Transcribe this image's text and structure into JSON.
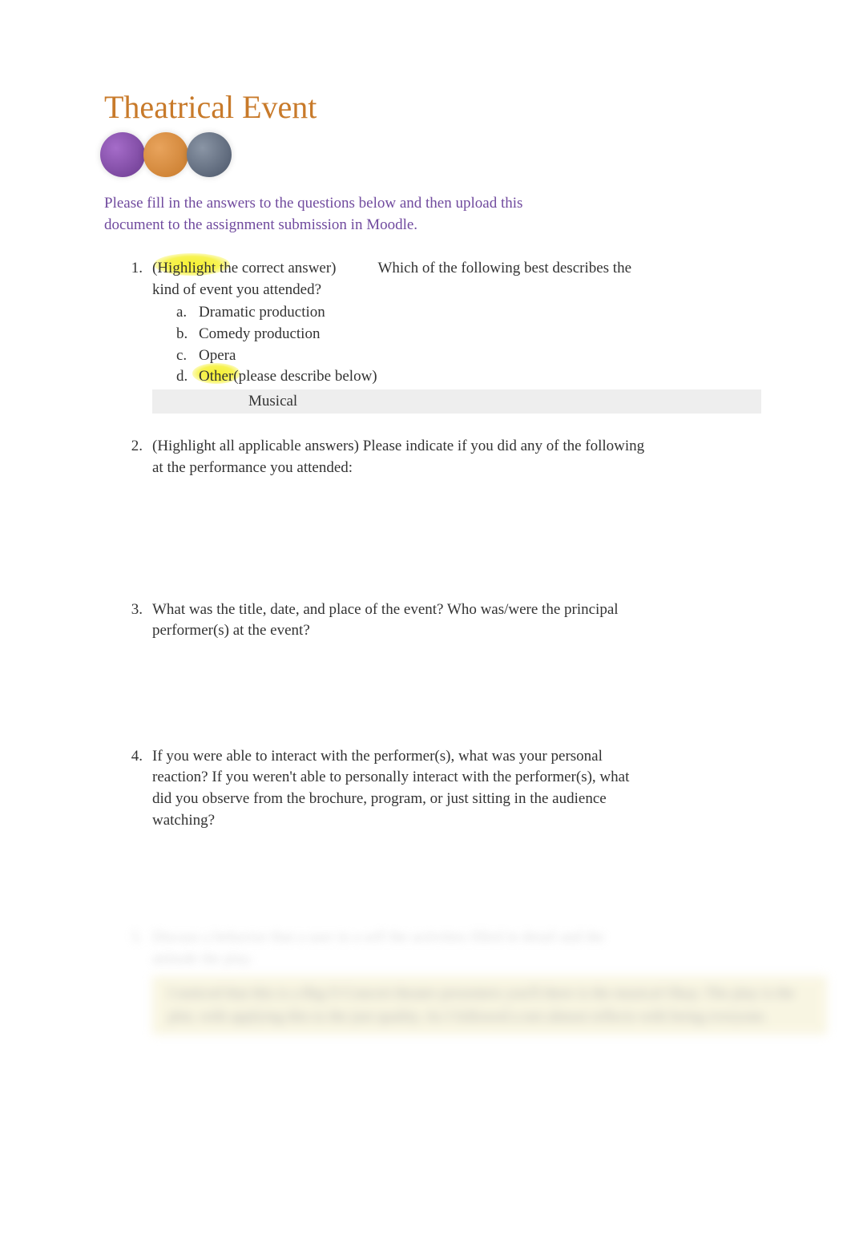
{
  "title": "Theatrical Event",
  "intro": "Please fill in the answers to the questions below and then upload this document to the assignment submission in Moodle.",
  "questions": {
    "q1": {
      "num": "1.",
      "prefix_paren": "(",
      "highlight_text": "Highlight t",
      "prefix_rest": "he correct answer)",
      "spacer": "           ",
      "main": "Which of the following best describes the kind of event you attended?",
      "options": {
        "a": {
          "letter": "a.",
          "text": "Dramatic production"
        },
        "b": {
          "letter": "b.",
          "text": "Comedy production"
        },
        "c": {
          "letter": "c.",
          "text": "Opera"
        },
        "d": {
          "letter": "d.",
          "highlight": "Other ",
          "rest": "(please describe below)"
        }
      },
      "answer": "Musical"
    },
    "q2": {
      "num": "2.",
      "text": "(Highlight all applicable answers)             Please indicate if you did any of the following at the performance you attended:"
    },
    "q3": {
      "num": "3.",
      "text": "What was the title, date, and place of the event? Who was/were the principal performer(s) at the event?"
    },
    "q4": {
      "num": "4.",
      "text": "If you were able to interact with the performer(s), what was your personal reaction? If you weren't able to personally interact with the performer(s), what did you observe from the brochure, program, or just sitting in the audience watching?"
    },
    "q5": {
      "num": "5.",
      "text": "Discuss a behavior that a user in a self the activities filled in detail and the attitude the play.",
      "answer": "I noticed that this is a Big O Concert theater presenters you'll there is the musical Okay. The play is the plot, with applying this to the just quality. As I followed a not almost reflects with being everyone."
    }
  }
}
